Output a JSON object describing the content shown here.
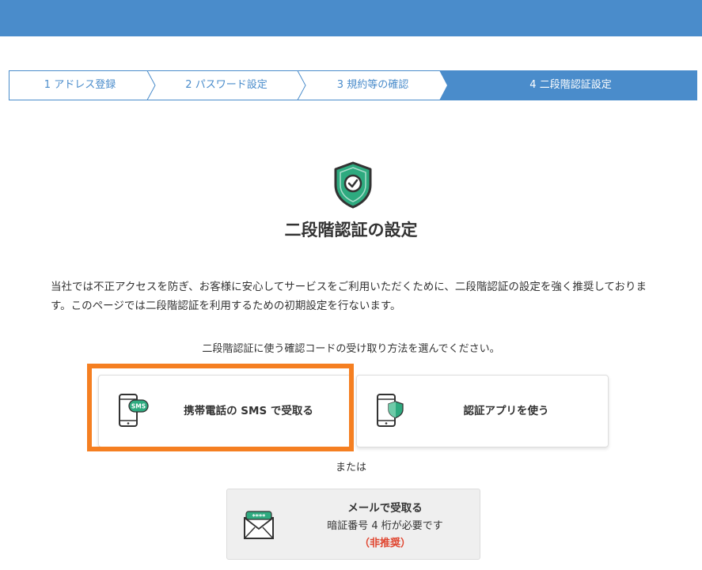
{
  "steps": [
    {
      "label": "1 アドレス登録",
      "active": false
    },
    {
      "label": "2 パスワード設定",
      "active": false
    },
    {
      "label": "3 規約等の確認",
      "active": false
    },
    {
      "label": "4 二段階認証設定",
      "active": true
    }
  ],
  "page": {
    "title": "二段階認証の設定",
    "description": "当社では不正アクセスを防ぎ、お客様に安心してサービスをご利用いただくために、二段階認証の設定を強く推奨しております。このページでは二段階認証を利用するための初期設定を行ないます。",
    "choose_text": "二段階認証に使う確認コードの受け取り方法を選んでください。"
  },
  "options": {
    "sms": {
      "label": "携帯電話の SMS で受取る",
      "icon_text": "SMS"
    },
    "app": {
      "label": "認証アプリを使う"
    },
    "or_text": "または",
    "mail": {
      "title": "メールで受取る",
      "subtitle": "暗証番号 4 桁が必要です",
      "note": "（非推奨）",
      "icon_text": "****"
    }
  },
  "colors": {
    "topbar": "#4a8ccb",
    "step_active": "#4a8ccb",
    "shield": "#2eaa7f",
    "highlight": "#f57f21",
    "note": "#e0452f"
  }
}
